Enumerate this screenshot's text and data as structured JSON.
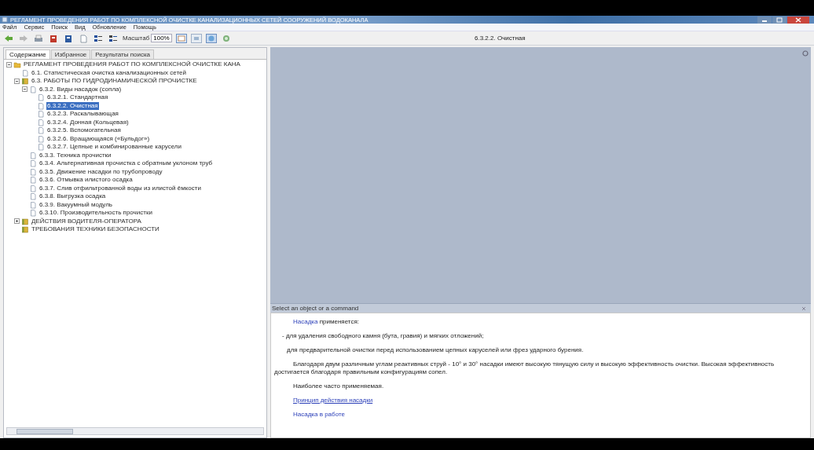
{
  "window": {
    "title": "РЕГЛАМЕНТ ПРОВЕДЕНИЯ РАБОТ ПО КОМПЛЕКСНОЙ ОЧИСТКЕ КАНАЛИЗАЦИОННЫХ СЕТЕЙ СООРУЖЕНИЙ ВОДОКАНАЛА"
  },
  "menu": [
    "Файл",
    "Сервис",
    "Поиск",
    "Вид",
    "Обновление",
    "Помощь"
  ],
  "toolbar": {
    "zoom_label": "Масштаб",
    "zoom_value": "100%"
  },
  "sidebar": {
    "tabs": [
      {
        "label": "Содержание",
        "selected": true
      },
      {
        "label": "Избранное",
        "selected": false
      },
      {
        "label": "Результаты поиска",
        "selected": false
      }
    ],
    "tree": [
      {
        "label": "РЕГЛАМЕНТ ПРОВЕДЕНИЯ РАБОТ ПО КОМПЛЕКСНОЙ ОЧИСТКЕ КАНА",
        "kind": "chapter",
        "expanded": true,
        "selected": false,
        "children": [
          {
            "label": "6.1. Статистическая очистка канализационных сетей",
            "kind": "topic",
            "selected": false
          },
          {
            "label": "6.3. РАБОТЫ ПО ГИДРОДИНАМИЧЕСКОЙ ПРОЧИСТКЕ",
            "kind": "book",
            "expanded": true,
            "selected": false,
            "children": [
              {
                "label": "6.3.2. Виды насадок (сопла)",
                "kind": "topic",
                "expanded": true,
                "selected": false,
                "children": [
                  {
                    "label": "6.3.2.1. Стандартная",
                    "kind": "topic",
                    "selected": false
                  },
                  {
                    "label": "6.3.2.2. Очистная",
                    "kind": "topic",
                    "selected": true
                  },
                  {
                    "label": "6.3.2.3. Раскалывающая",
                    "kind": "topic",
                    "selected": false
                  },
                  {
                    "label": "6.3.2.4. Донная (Кольцевая)",
                    "kind": "topic",
                    "selected": false
                  },
                  {
                    "label": "6.3.2.5. Вспомогательная",
                    "kind": "topic",
                    "selected": false
                  },
                  {
                    "label": "6.3.2.6. Вращающаяся («Бульдог»)",
                    "kind": "topic",
                    "selected": false
                  },
                  {
                    "label": "6.3.2.7. Цепные и комбинированные карусели",
                    "kind": "topic",
                    "selected": false
                  }
                ]
              },
              {
                "label": "6.3.3. Техника прочистки",
                "kind": "topic",
                "selected": false
              },
              {
                "label": "6.3.4. Альтернативная прочистка с обратным уклоном труб",
                "kind": "topic",
                "selected": false
              },
              {
                "label": "6.3.5. Движение насадки по трубопроводу",
                "kind": "topic",
                "selected": false
              },
              {
                "label": "6.3.6. Отмывка илистого осадка",
                "kind": "topic",
                "selected": false
              },
              {
                "label": "6.3.7. Слив отфильтрованной воды из илистой ёмкости",
                "kind": "topic",
                "selected": false
              },
              {
                "label": "6.3.8. Выгрузка осадка",
                "kind": "topic",
                "selected": false
              },
              {
                "label": "6.3.9. Вакуумный модуль",
                "kind": "topic",
                "selected": false
              },
              {
                "label": "6.3.10. Производительность прочистки",
                "kind": "topic",
                "selected": false
              }
            ]
          },
          {
            "label": "ДЕЙСТВИЯ ВОДИТЕЛЯ-ОПЕРАТОРА",
            "kind": "book",
            "expanded": false,
            "selected": false
          },
          {
            "label": "ТРЕБОВАНИЯ ТЕХНИКИ БЕЗОПАСНОСТИ",
            "kind": "book",
            "selected": false
          }
        ]
      }
    ]
  },
  "document": {
    "title": "6.3.2.2. Очистная",
    "viewer_status": "Select an object or a command",
    "paragraphs": [
      {
        "kind": "lead",
        "link": "Насадка",
        "text": "применяется:"
      },
      {
        "kind": "item",
        "text": "- для удаления свободного камня (бута, гравия) и мягких отложений;"
      },
      {
        "kind": "item2",
        "text": "для предварительной очистки перед использованием цепных каруселей или фрез ударного бурения."
      },
      {
        "kind": "para",
        "text": "Благодаря двум различным углам реактивных струй - 10° и 30° насадки имеют высокую тянущую силу и высокую эффективность очистки. Высокая эффективность достигается благодаря правильным конфигурациям сопел."
      },
      {
        "kind": "para",
        "text": "Наиболее часто применяемая."
      },
      {
        "kind": "link",
        "text": "Принцип действия насадки",
        "underline": true
      },
      {
        "kind": "link",
        "text": "Насадка в работе",
        "underline": false
      }
    ]
  }
}
